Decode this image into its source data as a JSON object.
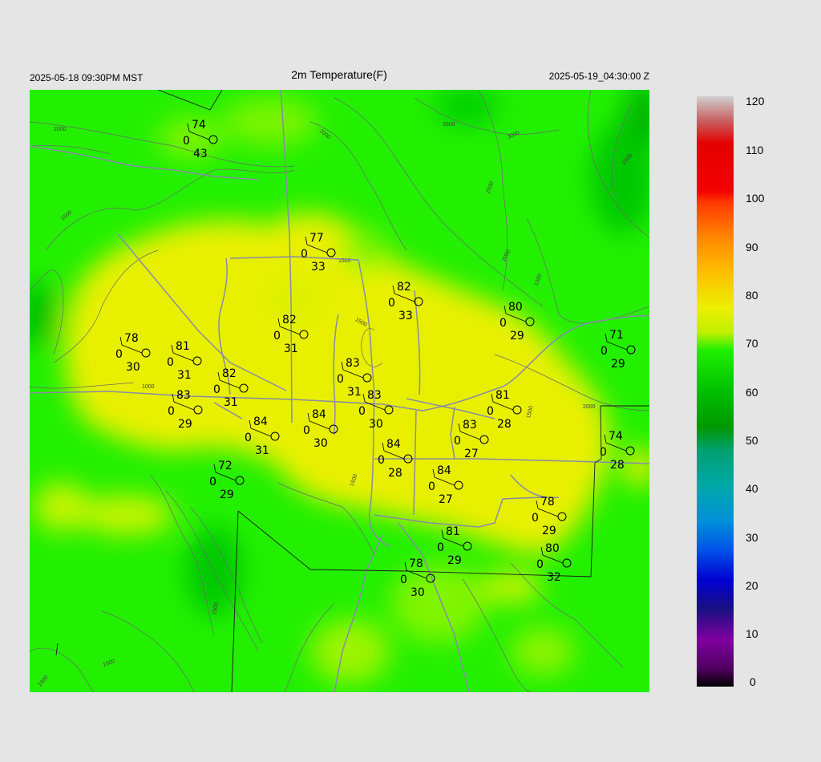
{
  "header": {
    "local_time": "2025-05-18 09:30PM MST",
    "title": "2m Temperature(F)",
    "utc_time": "2025-05-19_04:30:00 Z"
  },
  "colorbar": {
    "labels": [
      "120",
      "110",
      "100",
      "90",
      "80",
      "70",
      "60",
      "50",
      "40",
      "30",
      "20",
      "10",
      "0"
    ],
    "stops": [
      "#ffffff",
      "#ff0000",
      "#ff8000",
      "#ffd000",
      "#e6f000",
      "#00f000",
      "#00a000",
      "#00a0a0",
      "#0090e0",
      "#0000c0",
      "#8000a0",
      "#000000"
    ]
  },
  "contour_labels": [
    "2000",
    "2000",
    "3500",
    "3000",
    "1500",
    "2500",
    "2000",
    "1500",
    "2500",
    "1500",
    "1000",
    "1500",
    "2000",
    "1500",
    "1500",
    "1500",
    "1500",
    "1500"
  ],
  "stations": [
    {
      "temp": "74",
      "dew": "43",
      "wind": "0"
    },
    {
      "temp": "77",
      "dew": "33",
      "wind": "0"
    },
    {
      "temp": "82",
      "dew": "33",
      "wind": "0"
    },
    {
      "temp": "80",
      "dew": "29",
      "wind": "0"
    },
    {
      "temp": "82",
      "dew": "31",
      "wind": "0"
    },
    {
      "temp": "78",
      "dew": "30",
      "wind": "0"
    },
    {
      "temp": "81",
      "dew": "31",
      "wind": "0"
    },
    {
      "temp": "83",
      "dew": "31",
      "wind": "0"
    },
    {
      "temp": "71",
      "dew": "29",
      "wind": "0"
    },
    {
      "temp": "82",
      "dew": "31",
      "wind": "0"
    },
    {
      "temp": "83",
      "dew": "30",
      "wind": "0"
    },
    {
      "temp": "83",
      "dew": "29",
      "wind": "0"
    },
    {
      "temp": "81",
      "dew": "28",
      "wind": "0"
    },
    {
      "temp": "84",
      "dew": "30",
      "wind": "0"
    },
    {
      "temp": "83",
      "dew": "27",
      "wind": "0"
    },
    {
      "temp": "84",
      "dew": "31",
      "wind": "0"
    },
    {
      "temp": "84",
      "dew": "28",
      "wind": "0"
    },
    {
      "temp": "74",
      "dew": "28",
      "wind": "0"
    },
    {
      "temp": "84",
      "dew": "27",
      "wind": "0"
    },
    {
      "temp": "72",
      "dew": "29",
      "wind": "0"
    },
    {
      "temp": "78",
      "dew": "29",
      "wind": "0"
    },
    {
      "temp": "81",
      "dew": "29",
      "wind": "0"
    },
    {
      "temp": "80",
      "dew": "32",
      "wind": "0"
    },
    {
      "temp": "78",
      "dew": "30",
      "wind": "0"
    }
  ]
}
